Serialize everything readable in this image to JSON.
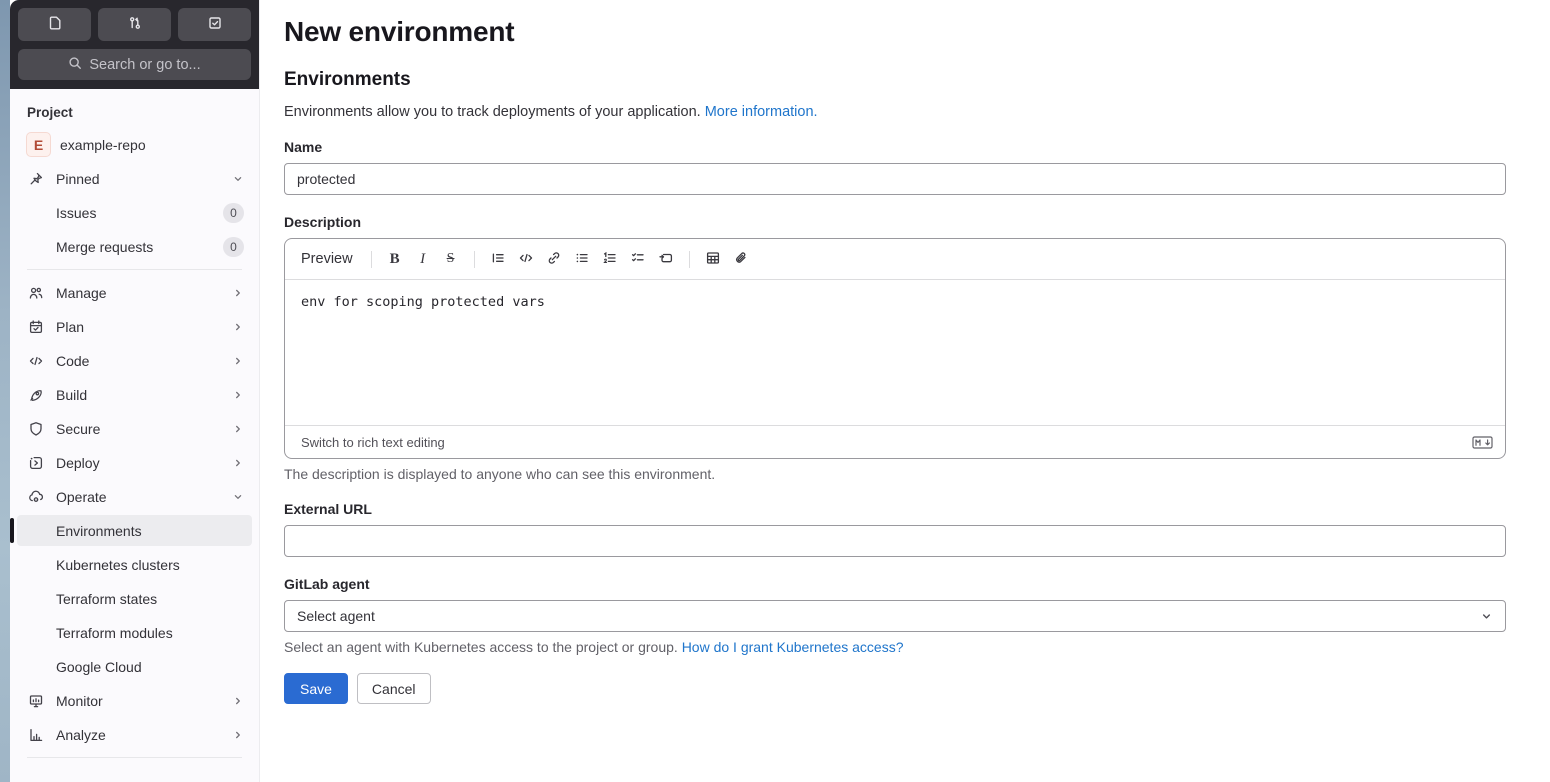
{
  "colors": {
    "accent_blue": "#2a6bd2",
    "link_blue": "#1f75cb",
    "topbar_bg": "#28272d",
    "sidebar_bg": "#fbfafd"
  },
  "topbar": {
    "search_placeholder": "Search or go to...",
    "buttons": [
      {
        "name": "issues",
        "icon": "issues-icon"
      },
      {
        "name": "merge-requests",
        "icon": "merge-request-icon"
      },
      {
        "name": "todo-list",
        "icon": "task-done-icon"
      }
    ]
  },
  "sidebar": {
    "section_label": "Project",
    "project": {
      "avatar_letter": "E",
      "name": "example-repo"
    },
    "pinned": {
      "label": "Pinned",
      "items": [
        {
          "label": "Issues",
          "badge": "0"
        },
        {
          "label": "Merge requests",
          "badge": "0"
        }
      ]
    },
    "nav": [
      {
        "label": "Manage"
      },
      {
        "label": "Plan"
      },
      {
        "label": "Code"
      },
      {
        "label": "Build"
      },
      {
        "label": "Secure"
      },
      {
        "label": "Deploy"
      },
      {
        "label": "Operate"
      }
    ],
    "operate_children": [
      {
        "label": "Environments",
        "active": true
      },
      {
        "label": "Kubernetes clusters"
      },
      {
        "label": "Terraform states"
      },
      {
        "label": "Terraform modules"
      },
      {
        "label": "Google Cloud"
      }
    ],
    "nav_bottom": [
      {
        "label": "Monitor"
      },
      {
        "label": "Analyze"
      }
    ]
  },
  "main": {
    "title": "New environment",
    "section_title": "Environments",
    "intro_text": "Environments allow you to track deployments of your application. ",
    "intro_link": "More information.",
    "name_field": {
      "label": "Name",
      "value": "protected"
    },
    "description_field": {
      "label": "Description",
      "preview_label": "Preview",
      "value": "env for scoping protected vars",
      "switch_label": "Switch to rich text editing",
      "help": "The description is displayed to anyone who can see this environment."
    },
    "external_url_field": {
      "label": "External URL",
      "value": ""
    },
    "agent_field": {
      "label": "GitLab agent",
      "selected": "Select agent",
      "help_text": "Select an agent with Kubernetes access to the project or group. ",
      "help_link": "How do I grant Kubernetes access?"
    },
    "actions": {
      "save": "Save",
      "cancel": "Cancel"
    }
  }
}
